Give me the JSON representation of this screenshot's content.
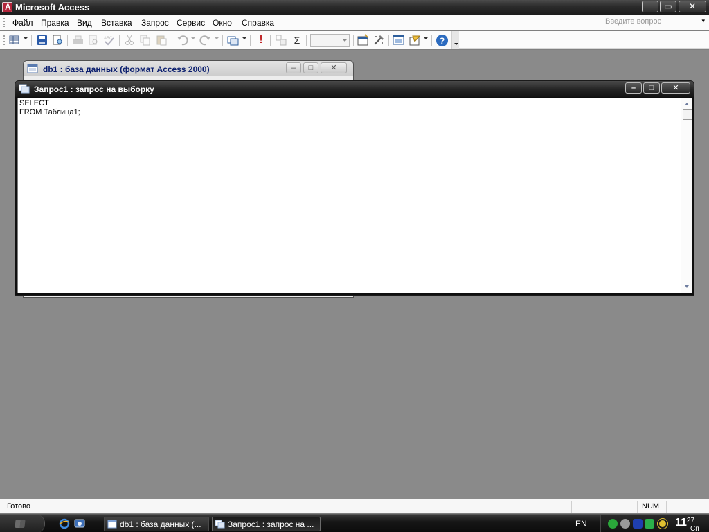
{
  "app": {
    "title": "Microsoft Access",
    "minimize_label": "_",
    "maximize_label": "▭",
    "close_label": "✕"
  },
  "menu": {
    "items": [
      "Файл",
      "Правка",
      "Вид",
      "Вставка",
      "Запрос",
      "Сервис",
      "Окно",
      "Справка"
    ],
    "help_placeholder": "Введите вопрос"
  },
  "toolbar": {
    "icons": [
      "datasheet-view-icon",
      "save-icon",
      "file-search-icon",
      "print-icon",
      "print-preview-icon",
      "spelling-icon",
      "cut-icon",
      "copy-icon",
      "paste-icon",
      "undo-icon",
      "redo-icon",
      "query-type-icon",
      "run-icon",
      "show-table-icon",
      "totals-icon",
      "top-values-combo",
      "properties-icon",
      "builder-icon",
      "database-window-icon",
      "new-object-icon",
      "help-icon"
    ],
    "totals_symbol": "Σ",
    "run_symbol": "!",
    "help_symbol": "?"
  },
  "db_window": {
    "title": "db1 : база данных (формат Access 2000)",
    "minimize_label": "–",
    "maximize_label": "□",
    "close_label": "✕"
  },
  "query_window": {
    "title": "Запрос1 : запрос на выборку",
    "minimize_label": "–",
    "maximize_label": "□",
    "close_label": "✕",
    "sql_text": "SELECT\nFROM Таблица1;"
  },
  "status": {
    "text": "Готово",
    "num_indicator": "NUM"
  },
  "taskbar": {
    "tasks": [
      {
        "label": "db1 : база данных (..."
      },
      {
        "label": "Запрос1 : запрос на ..."
      }
    ],
    "language": "EN",
    "clock_hour": "11",
    "clock_minutes": "27",
    "clock_day": "Сп"
  },
  "colors": {
    "workspace": "#8a8a8a",
    "titlebar_dark": "#1c1c1c",
    "db_title_text": "#0a1e6e"
  }
}
